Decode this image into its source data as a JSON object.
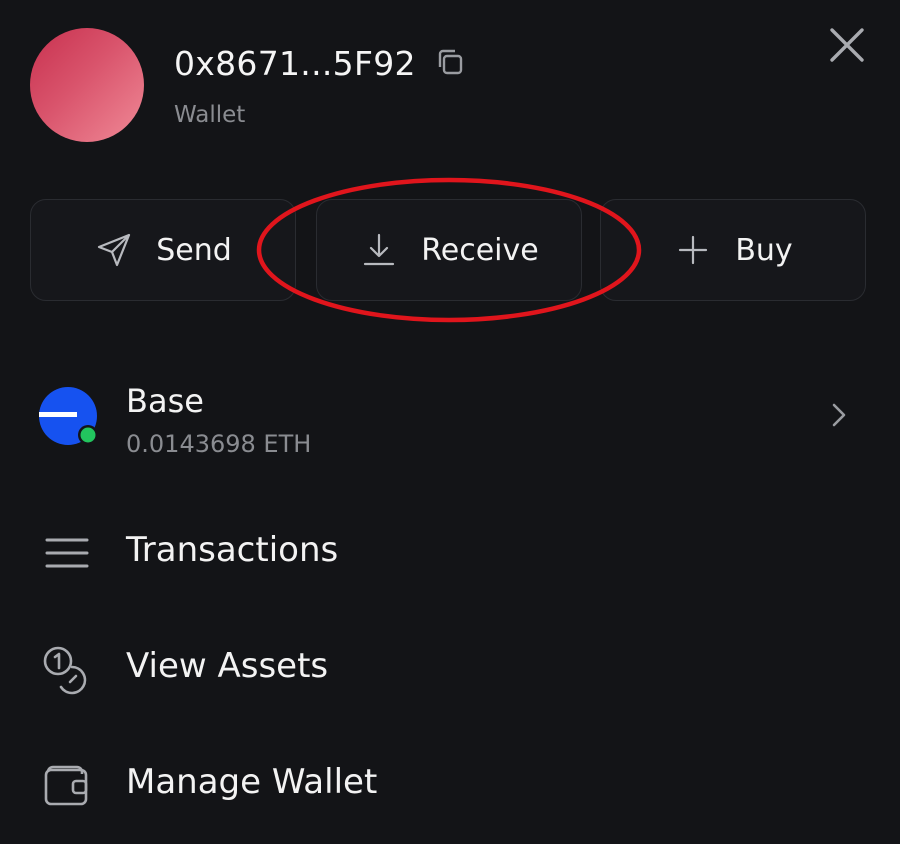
{
  "header": {
    "address": "0x8671...5F92",
    "subtitle": "Wallet"
  },
  "actions": {
    "send_label": "Send",
    "receive_label": "Receive",
    "buy_label": "Buy"
  },
  "network": {
    "name": "Base",
    "balance": "0.0143698 ETH"
  },
  "menu": {
    "transactions_label": "Transactions",
    "assets_label": "View Assets",
    "manage_label": "Manage Wallet"
  },
  "icons": {
    "copy": "copy-icon",
    "close": "close-icon",
    "send": "send-arrow-icon",
    "receive": "download-icon",
    "buy": "plus-icon",
    "network": "base-logo-icon",
    "chevron": "chevron-right-icon",
    "transactions": "list-icon",
    "assets": "coins-icon",
    "manage": "wallet-icon"
  },
  "colors": {
    "background": "#131417",
    "highlight_ring": "#e0151c",
    "base_blue": "#1652f0",
    "online_dot": "#22c55e",
    "avatar_gradient_start": "#c8314f",
    "avatar_gradient_end": "#f08a97"
  }
}
